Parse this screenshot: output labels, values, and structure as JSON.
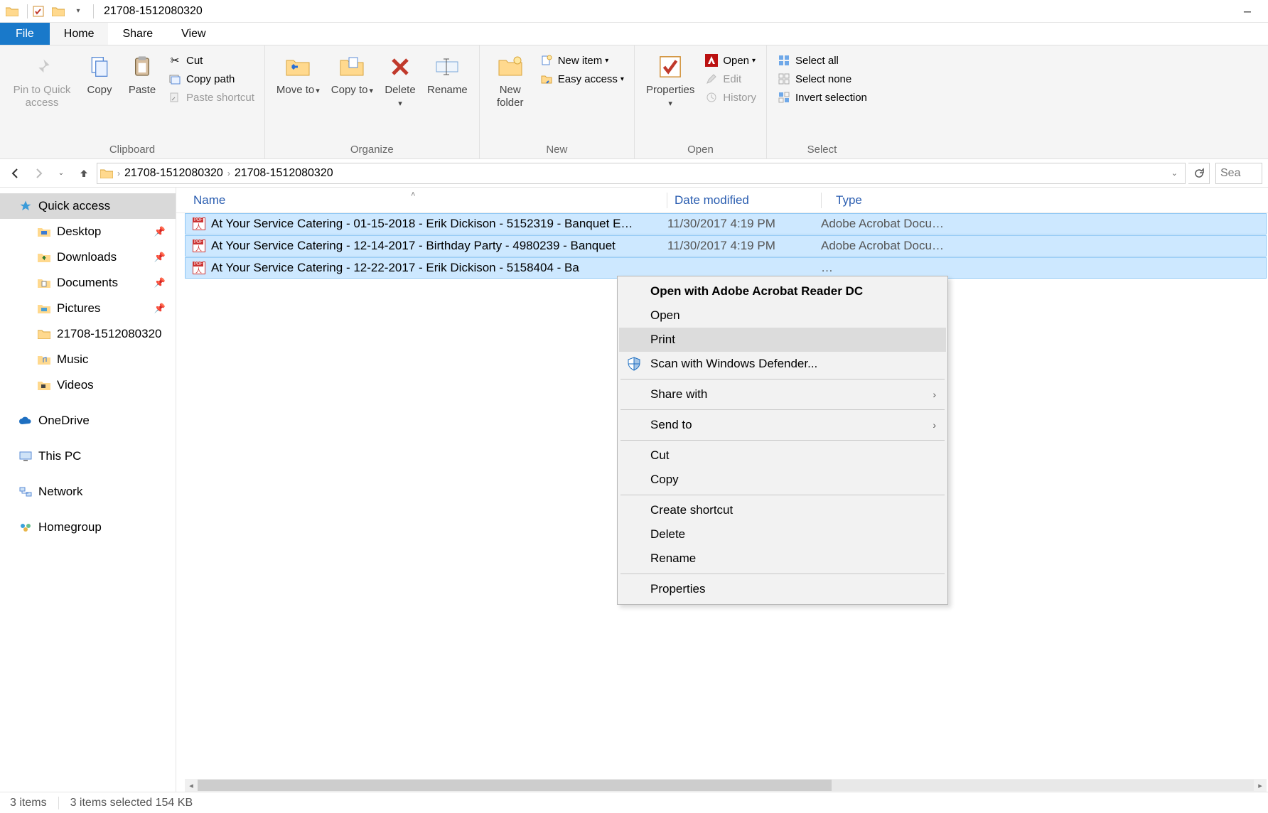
{
  "window": {
    "title": "21708-1512080320"
  },
  "tabs": {
    "file": "File",
    "home": "Home",
    "share": "Share",
    "view": "View"
  },
  "ribbon": {
    "clipboard": {
      "label": "Clipboard",
      "pin": "Pin to Quick access",
      "copy": "Copy",
      "paste": "Paste",
      "cut": "Cut",
      "copy_path": "Copy path",
      "paste_shortcut": "Paste shortcut"
    },
    "organize": {
      "label": "Organize",
      "move_to": "Move to",
      "copy_to": "Copy to",
      "delete": "Delete",
      "rename": "Rename"
    },
    "new": {
      "label": "New",
      "new_folder": "New folder",
      "new_item": "New item",
      "easy_access": "Easy access"
    },
    "open": {
      "label": "Open",
      "properties": "Properties",
      "open": "Open",
      "edit": "Edit",
      "history": "History"
    },
    "select": {
      "label": "Select",
      "select_all": "Select all",
      "select_none": "Select none",
      "invert": "Invert selection"
    }
  },
  "breadcrumb": {
    "items": [
      "21708-1512080320",
      "21708-1512080320"
    ]
  },
  "search": {
    "placeholder": "Sea"
  },
  "sidebar": {
    "quick_access": "Quick access",
    "desktop": "Desktop",
    "downloads": "Downloads",
    "documents": "Documents",
    "pictures": "Pictures",
    "recent_folder": "21708-1512080320",
    "music": "Music",
    "videos": "Videos",
    "onedrive": "OneDrive",
    "this_pc": "This PC",
    "network": "Network",
    "homegroup": "Homegroup"
  },
  "columns": {
    "name": "Name",
    "date": "Date modified",
    "type": "Type"
  },
  "files": [
    {
      "name": "At Your Service Catering - 01-15-2018 - Erik Dickison - 5152319 - Banquet E…",
      "date": "11/30/2017 4:19 PM",
      "type": "Adobe Acrobat Docu…"
    },
    {
      "name": "At Your Service Catering - 12-14-2017 - Birthday Party - 4980239 - Banquet",
      "date": "11/30/2017 4:19 PM",
      "type": "Adobe Acrobat Docu…"
    },
    {
      "name": "At Your Service Catering - 12-22-2017 - Erik Dickison - 5158404 - Ba",
      "date": "",
      "type": "…"
    }
  ],
  "context_menu": {
    "open_with": "Open with Adobe Acrobat Reader DC",
    "open": "Open",
    "print": "Print",
    "scan": "Scan with Windows Defender...",
    "share_with": "Share with",
    "send_to": "Send to",
    "cut": "Cut",
    "copy": "Copy",
    "create_shortcut": "Create shortcut",
    "delete": "Delete",
    "rename": "Rename",
    "properties": "Properties"
  },
  "status": {
    "count": "3 items",
    "selection": "3 items selected  154 KB"
  }
}
